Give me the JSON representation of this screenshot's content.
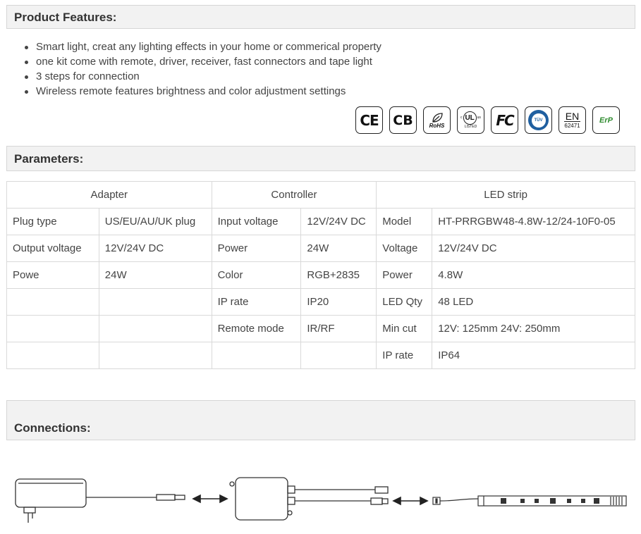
{
  "features_header": "Product Features:",
  "features": [
    "Smart light, creat any lighting effects in your home or commerical property",
    "one kit come with remote, driver, receiver, fast connectors and tape light",
    "3 steps for connection",
    "Wireless remote features brightness and color adjustment settings"
  ],
  "certifications": [
    {
      "icon": "ce-mark-icon",
      "text": "CE"
    },
    {
      "icon": "cb-mark-icon",
      "text": "CB"
    },
    {
      "icon": "rohs-mark-icon",
      "text": "RoHS"
    },
    {
      "icon": "ul-listed-icon",
      "text": "LISTED"
    },
    {
      "icon": "fcc-mark-icon",
      "text": "FC"
    },
    {
      "icon": "tuv-mark-icon",
      "text": "TÜV"
    },
    {
      "icon": "en62471-mark-icon",
      "text_top": "EN",
      "text_bottom": "62471"
    },
    {
      "icon": "erp-mark-icon",
      "text": "ErP"
    }
  ],
  "parameters_header": "Parameters:",
  "table": {
    "groups": [
      "Adapter",
      "Controller",
      "LED strip"
    ],
    "rows": [
      [
        "Plug type",
        "US/EU/AU/UK plug",
        "Input voltage",
        "12V/24V DC",
        "Model",
        "HT-PRRGBW48-4.8W-12/24-10F0-05"
      ],
      [
        "Output voltage",
        "12V/24V DC",
        "Power",
        "24W",
        "Voltage",
        "12V/24V DC"
      ],
      [
        "Powe",
        "24W",
        "Color",
        "RGB+2835",
        "Power",
        "4.8W"
      ],
      [
        "",
        "",
        "IP rate",
        "IP20",
        "LED Qty",
        "48 LED"
      ],
      [
        "",
        "",
        "Remote mode",
        "IR/RF",
        "Min cut",
        "12V: 125mm 24V: 250mm"
      ],
      [
        "",
        "",
        "",
        "",
        "IP rate",
        "IP64"
      ]
    ]
  },
  "connections_header": "Connections:",
  "colors": {
    "header_bg": "#f2f2f2",
    "border": "#d9d9d9",
    "text": "#444444",
    "erp_green": "#2e8b2e"
  }
}
